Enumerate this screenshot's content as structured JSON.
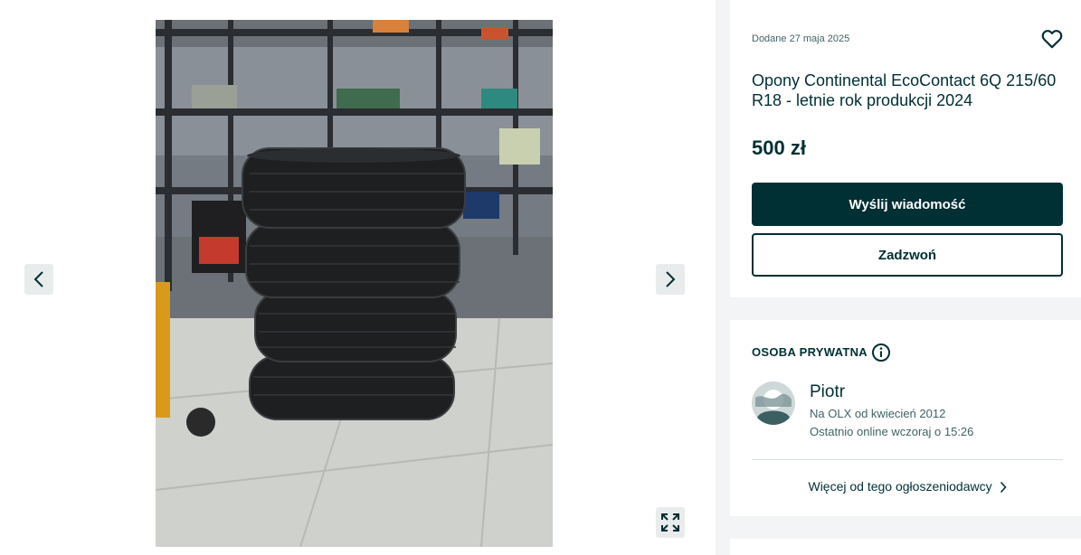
{
  "gallery": {
    "photo_alt": "Opony Continental EcoContact 6Q",
    "icons": {
      "prev": "chevron-left-icon",
      "next": "chevron-right-icon",
      "fullscreen": "expand-icon"
    }
  },
  "offer": {
    "added_date": "Dodane 27 maja 2025",
    "title": "Opony Continental EcoContact 6Q 215/60 R18 - letnie rok produkcji 2024",
    "price": "500 zł",
    "message_button": "Wyślij wiadomość",
    "call_button": "Zadzwoń",
    "favorite_icon": "heart-icon"
  },
  "seller": {
    "type_label": "OSOBA PRYWATNA",
    "info_icon": "info-icon",
    "name": "Piotr",
    "member_since": "Na OLX od kwiecień 2012",
    "last_online": "Ostatnio online wczoraj o 15:26",
    "more_from_seller": "Więcej od tego ogłoszeniodawcy"
  },
  "colors": {
    "primary": "#002f34",
    "secondary_text": "#406367",
    "page_background": "#f2f4f5",
    "card_background": "#ffffff"
  }
}
